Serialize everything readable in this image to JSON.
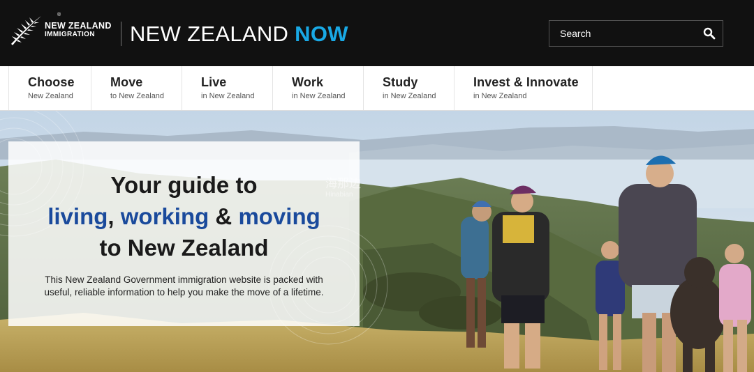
{
  "header": {
    "brand_line1": "NEW ZEALAND",
    "brand_line2": "IMMIGRATION",
    "registered_mark": "®",
    "site_title_main": "NEW ZEALAND ",
    "site_title_accent": "NOW",
    "search_placeholder": "Search",
    "icons": {
      "logo": "silver-fern-icon",
      "search": "search-icon"
    },
    "colors": {
      "background": "#111111",
      "accent": "#19a9e5"
    }
  },
  "nav": {
    "items": [
      {
        "label": "Choose",
        "sub": "New Zealand"
      },
      {
        "label": "Move",
        "sub": "to New Zealand"
      },
      {
        "label": "Live",
        "sub": "in New Zealand"
      },
      {
        "label": "Work",
        "sub": "in New Zealand"
      },
      {
        "label": "Study",
        "sub": "in New Zealand"
      },
      {
        "label": "Invest & Innovate",
        "sub": "in New Zealand"
      }
    ]
  },
  "hero": {
    "heading_line1": "Your guide to",
    "heading_word1": "living",
    "heading_sep1": ", ",
    "heading_word2": "working",
    "heading_sep2": " & ",
    "heading_word3": "moving",
    "heading_line3": "to New Zealand",
    "description": "This New Zealand Government immigration website is packed with useful, reliable information to help you make the move of a lifetime.",
    "watermark": "海那边",
    "watermark_sub": "Hinabian",
    "colors": {
      "highlight": "#1a4a9c"
    }
  }
}
